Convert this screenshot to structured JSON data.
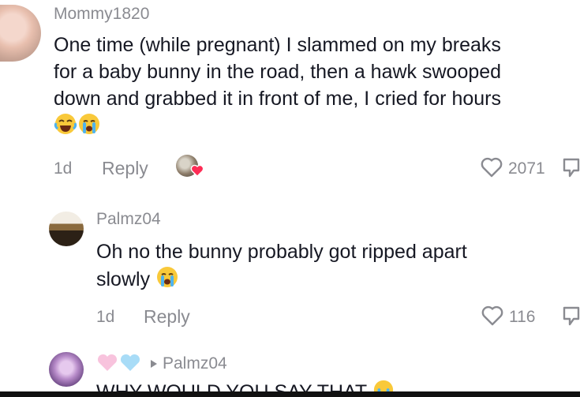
{
  "comments": [
    {
      "username": "Mommy1820",
      "text": "One time (while pregnant) I slammed on my breaks for a baby bunny in the road, then a hawk swooped down and grabbed it in front of me, I cried for hours",
      "line1": "One time (while pregnant) I slammed on my breaks",
      "line2": "for a baby bunny in the road, then a hawk swooped",
      "line3": "down and grabbed it in front of me, I cried for hours",
      "emojis": [
        "laughing-face-icon",
        "crying-face-icon"
      ],
      "age": "1d",
      "reply_label": "Reply",
      "likes": "2071"
    },
    {
      "username": "Palmz04",
      "line1": "Oh no the bunny probably got ripped apart",
      "line2": "slowly",
      "emojis": [
        "crying-face-icon"
      ],
      "age": "1d",
      "reply_label": "Reply",
      "likes": "116"
    },
    {
      "reply_to": "Palmz04",
      "text_partial": "WHY WOULD YOU SAY THAT",
      "emojis": [
        "pink-heart-icon",
        "blue-heart-icon",
        "crying-face-icon"
      ]
    }
  ],
  "colors": {
    "text": "#161823",
    "muted": "#8a8b91",
    "heart_outline": "#8a8b91",
    "liked_heart": "#fe2c55"
  }
}
